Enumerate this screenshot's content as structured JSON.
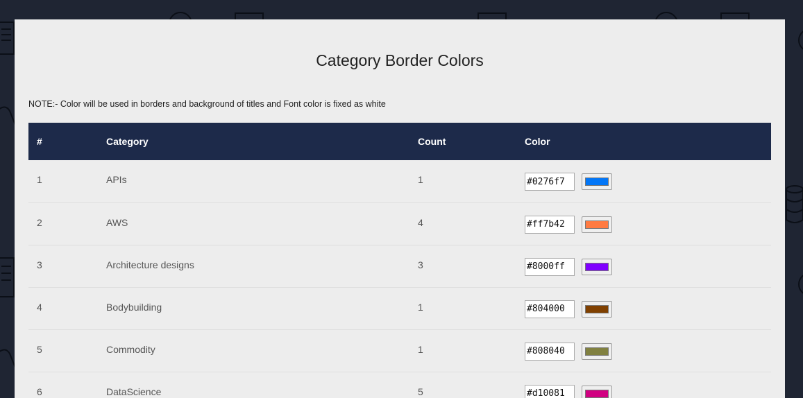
{
  "page": {
    "title": "Category Border Colors",
    "note": "NOTE:- Color will be used in borders and background of titles and Font color is fixed as white"
  },
  "table": {
    "headers": {
      "index": "#",
      "category": "Category",
      "count": "Count",
      "color": "Color"
    },
    "rows": [
      {
        "index": "1",
        "category": "APIs",
        "count": "1",
        "color": "#0276f7"
      },
      {
        "index": "2",
        "category": "AWS",
        "count": "4",
        "color": "#ff7b42"
      },
      {
        "index": "3",
        "category": "Architecture designs",
        "count": "3",
        "color": "#8000ff"
      },
      {
        "index": "4",
        "category": "Bodybuilding",
        "count": "1",
        "color": "#804000"
      },
      {
        "index": "5",
        "category": "Commodity",
        "count": "1",
        "color": "#808040"
      },
      {
        "index": "6",
        "category": "DataScience",
        "count": "5",
        "color": "#d10081"
      }
    ]
  },
  "colors": {
    "page_background": "#1f2533",
    "card_background": "#ededed",
    "header_background": "#1d2a4a",
    "header_text": "#ffffff"
  }
}
